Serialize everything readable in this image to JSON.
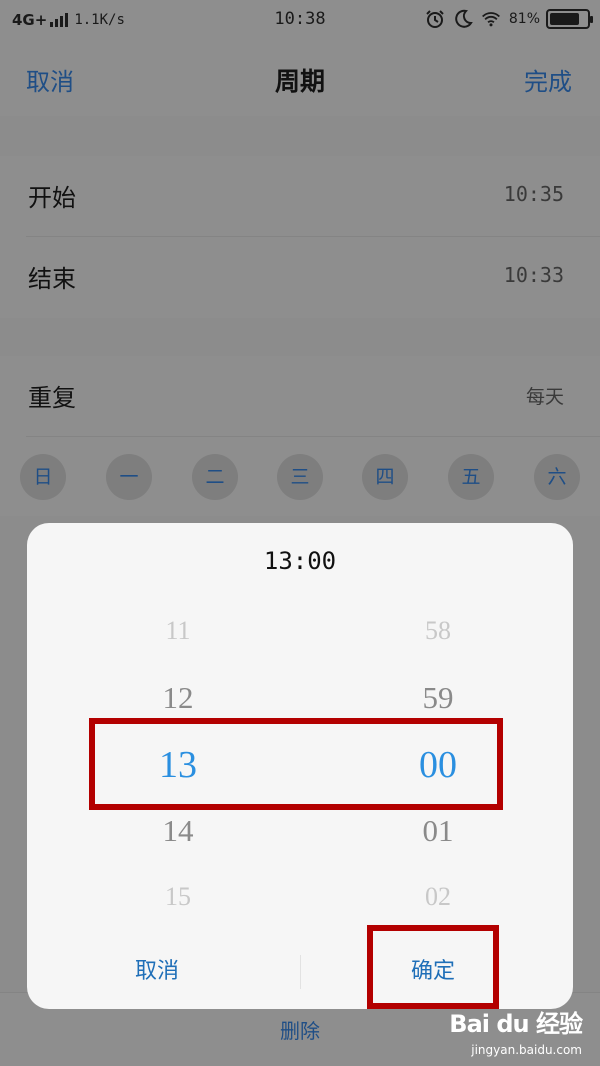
{
  "status_bar": {
    "network": "4G+",
    "speed": "1.1K/s",
    "time": "10:38",
    "battery": "81%",
    "battery_level": 0.81,
    "icons": [
      "alarm-icon",
      "moon-icon",
      "wifi-icon"
    ]
  },
  "nav": {
    "cancel": "取消",
    "title": "周期",
    "done": "完成"
  },
  "schedule": {
    "start_label": "开始",
    "start_value": "10:35",
    "end_label": "结束",
    "end_value": "10:33",
    "repeat_label": "重复",
    "repeat_value": "每天"
  },
  "days": [
    "日",
    "一",
    "二",
    "三",
    "四",
    "五",
    "六"
  ],
  "dialog": {
    "title": "13:00",
    "hours": [
      "11",
      "12",
      "13",
      "14",
      "15"
    ],
    "minutes": [
      "58",
      "59",
      "00",
      "01",
      "02"
    ],
    "cancel": "取消",
    "ok": "确定"
  },
  "bottom": {
    "delete": "删除"
  },
  "watermark": {
    "brand": "Bai du 经验",
    "url": "jingyan.baidu.com"
  },
  "colors": {
    "accent": "#2a8fe0",
    "link": "#1f6fb8",
    "highlight": "#b30000"
  }
}
